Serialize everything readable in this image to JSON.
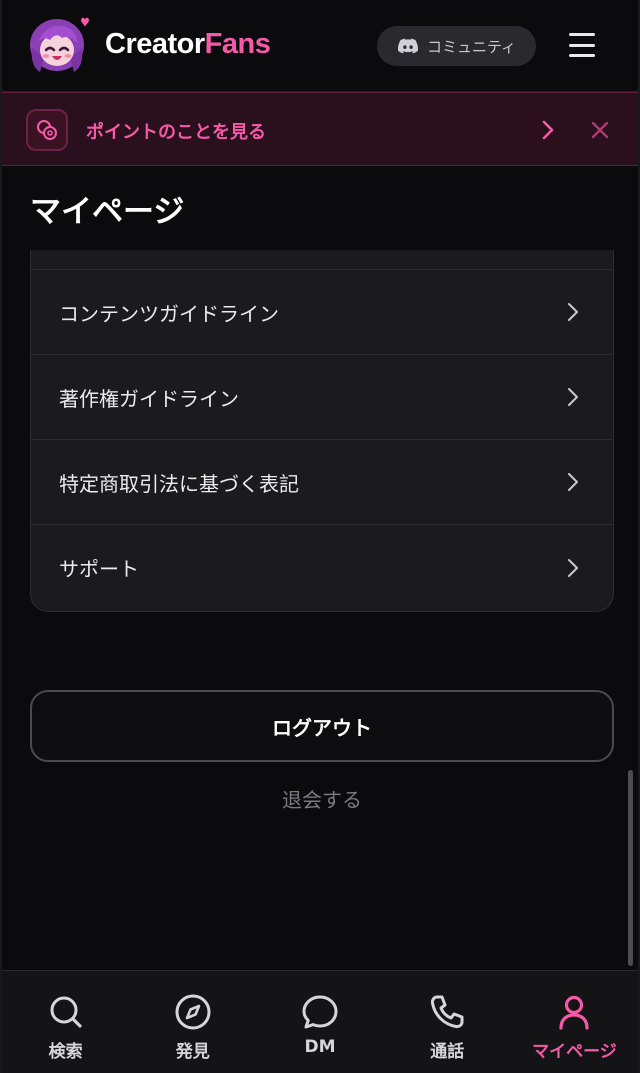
{
  "header": {
    "brand_part1": "Creator",
    "brand_part2": "Fans",
    "community_label": "コミュニティ"
  },
  "banner": {
    "text": "ポイントのことを見る"
  },
  "page": {
    "title": "マイページ"
  },
  "menu": {
    "items": [
      {
        "label": "コンテンツガイドライン"
      },
      {
        "label": "著作権ガイドライン"
      },
      {
        "label": "特定商取引法に基づく表記"
      },
      {
        "label": "サポート"
      }
    ]
  },
  "actions": {
    "logout_label": "ログアウト",
    "withdraw_label": "退会する"
  },
  "bottom_nav": {
    "items": [
      {
        "label": "検索",
        "icon": "search-icon"
      },
      {
        "label": "発見",
        "icon": "compass-icon"
      },
      {
        "label": "DM",
        "icon": "chat-icon"
      },
      {
        "label": "通話",
        "icon": "phone-icon"
      },
      {
        "label": "マイページ",
        "icon": "user-icon",
        "active": true
      }
    ]
  },
  "colors": {
    "accent": "#f55aa8",
    "background": "#0b0b0d",
    "card": "#1b1b1e",
    "banner_bg": "#2a0f1c"
  }
}
